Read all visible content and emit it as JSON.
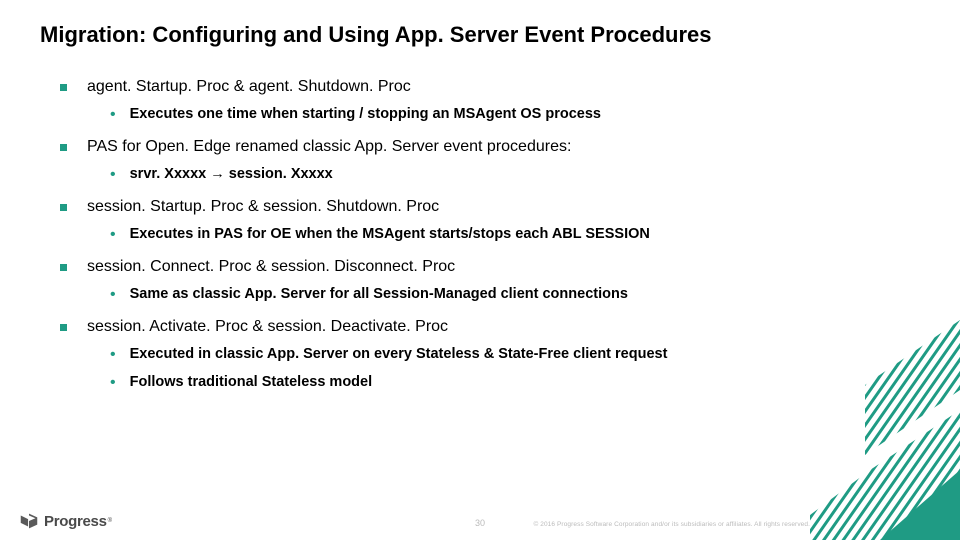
{
  "title": "Migration: Configuring and Using App. Server Event Procedures",
  "bullets": [
    {
      "text": "agent. Startup. Proc & agent. Shutdown. Proc",
      "sub": [
        "Executes one time when starting / stopping an MSAgent OS process"
      ]
    },
    {
      "text": "PAS for Open. Edge renamed classic App. Server event procedures:",
      "sub": [
        "srvr. Xxxxx → session. Xxxxx"
      ]
    },
    {
      "text": "session. Startup. Proc & session. Shutdown. Proc",
      "sub": [
        "Executes in PAS for OE when the MSAgent starts/stops each ABL SESSION"
      ]
    },
    {
      "text": "session. Connect. Proc & session. Disconnect. Proc",
      "sub": [
        "Same as classic App. Server for all Session-Managed client connections"
      ]
    },
    {
      "text": "session. Activate. Proc & session. Deactivate. Proc",
      "sub": [
        "Executed in classic App. Server on every Stateless & State-Free client request",
        "Follows traditional Stateless model"
      ]
    }
  ],
  "footer": {
    "page_number": "30",
    "copyright": "© 2016 Progress Software Corporation and/or its subsidiaries or affiliates. All rights reserved.",
    "brand": "Progress",
    "brand_r": "®"
  }
}
